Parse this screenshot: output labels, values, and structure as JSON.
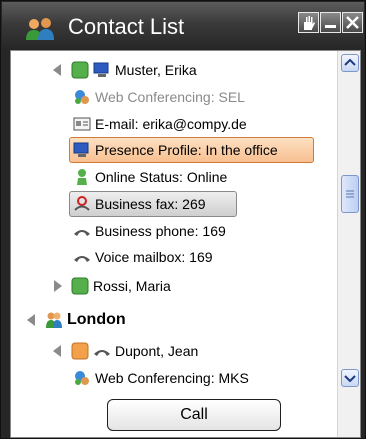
{
  "window": {
    "title": "Contact List",
    "buttons": [
      "hand",
      "minimize",
      "close"
    ]
  },
  "tree": [
    {
      "label": "Muster, Erika",
      "kind": "contact",
      "expanded": true,
      "status_color": "#55b04b"
    },
    {
      "label": "Web Conferencing: SEL",
      "kind": "detail",
      "disabled": true,
      "icon": "web-conferencing-icon"
    },
    {
      "label": "E-mail: erika@compy.de",
      "kind": "detail",
      "icon": "email-icon"
    },
    {
      "label": "Presence Profile: In the office",
      "kind": "detail",
      "icon": "presence-computer-icon",
      "highlight": "selected"
    },
    {
      "label": "Online Status: Online",
      "kind": "detail",
      "icon": "online-person-icon"
    },
    {
      "label": "Business fax: 269",
      "kind": "detail",
      "icon": "fax-icon",
      "highlight": "hover"
    },
    {
      "label": "Business phone: 169",
      "kind": "detail",
      "icon": "phone-icon"
    },
    {
      "label": "Voice mailbox: 169",
      "kind": "detail",
      "icon": "phone-icon"
    },
    {
      "label": "Rossi, Maria",
      "kind": "contact",
      "expanded": false,
      "status_color": "#55b04b"
    },
    {
      "label": "London",
      "kind": "group",
      "expanded": true
    },
    {
      "label": "Dupont, Jean",
      "kind": "contact",
      "expanded": true,
      "status_color": "#f3a04a"
    },
    {
      "label": "Web Conferencing: MKS",
      "kind": "detail",
      "icon": "web-conferencing-icon"
    }
  ],
  "call_button": "Call",
  "colors": {
    "titlebar": "#3a3a3a",
    "selected_highlight": "#f8c091",
    "hover_highlight": "#cfcfcf",
    "online_green": "#55b04b",
    "away_orange": "#f3a04a"
  }
}
